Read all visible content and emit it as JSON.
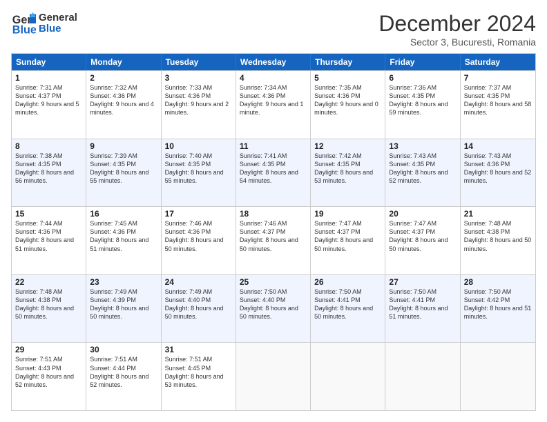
{
  "logo": {
    "line1": "General",
    "line2": "Blue"
  },
  "title": "December 2024",
  "subtitle": "Sector 3, Bucuresti, Romania",
  "header": {
    "days": [
      "Sunday",
      "Monday",
      "Tuesday",
      "Wednesday",
      "Thursday",
      "Friday",
      "Saturday"
    ]
  },
  "rows": [
    {
      "alt": false,
      "cells": [
        {
          "day": "1",
          "sunrise": "Sunrise: 7:31 AM",
          "sunset": "Sunset: 4:37 PM",
          "daylight": "Daylight: 9 hours and 5 minutes."
        },
        {
          "day": "2",
          "sunrise": "Sunrise: 7:32 AM",
          "sunset": "Sunset: 4:36 PM",
          "daylight": "Daylight: 9 hours and 4 minutes."
        },
        {
          "day": "3",
          "sunrise": "Sunrise: 7:33 AM",
          "sunset": "Sunset: 4:36 PM",
          "daylight": "Daylight: 9 hours and 2 minutes."
        },
        {
          "day": "4",
          "sunrise": "Sunrise: 7:34 AM",
          "sunset": "Sunset: 4:36 PM",
          "daylight": "Daylight: 9 hours and 1 minute."
        },
        {
          "day": "5",
          "sunrise": "Sunrise: 7:35 AM",
          "sunset": "Sunset: 4:36 PM",
          "daylight": "Daylight: 9 hours and 0 minutes."
        },
        {
          "day": "6",
          "sunrise": "Sunrise: 7:36 AM",
          "sunset": "Sunset: 4:35 PM",
          "daylight": "Daylight: 8 hours and 59 minutes."
        },
        {
          "day": "7",
          "sunrise": "Sunrise: 7:37 AM",
          "sunset": "Sunset: 4:35 PM",
          "daylight": "Daylight: 8 hours and 58 minutes."
        }
      ]
    },
    {
      "alt": true,
      "cells": [
        {
          "day": "8",
          "sunrise": "Sunrise: 7:38 AM",
          "sunset": "Sunset: 4:35 PM",
          "daylight": "Daylight: 8 hours and 56 minutes."
        },
        {
          "day": "9",
          "sunrise": "Sunrise: 7:39 AM",
          "sunset": "Sunset: 4:35 PM",
          "daylight": "Daylight: 8 hours and 55 minutes."
        },
        {
          "day": "10",
          "sunrise": "Sunrise: 7:40 AM",
          "sunset": "Sunset: 4:35 PM",
          "daylight": "Daylight: 8 hours and 55 minutes."
        },
        {
          "day": "11",
          "sunrise": "Sunrise: 7:41 AM",
          "sunset": "Sunset: 4:35 PM",
          "daylight": "Daylight: 8 hours and 54 minutes."
        },
        {
          "day": "12",
          "sunrise": "Sunrise: 7:42 AM",
          "sunset": "Sunset: 4:35 PM",
          "daylight": "Daylight: 8 hours and 53 minutes."
        },
        {
          "day": "13",
          "sunrise": "Sunrise: 7:43 AM",
          "sunset": "Sunset: 4:35 PM",
          "daylight": "Daylight: 8 hours and 52 minutes."
        },
        {
          "day": "14",
          "sunrise": "Sunrise: 7:43 AM",
          "sunset": "Sunset: 4:36 PM",
          "daylight": "Daylight: 8 hours and 52 minutes."
        }
      ]
    },
    {
      "alt": false,
      "cells": [
        {
          "day": "15",
          "sunrise": "Sunrise: 7:44 AM",
          "sunset": "Sunset: 4:36 PM",
          "daylight": "Daylight: 8 hours and 51 minutes."
        },
        {
          "day": "16",
          "sunrise": "Sunrise: 7:45 AM",
          "sunset": "Sunset: 4:36 PM",
          "daylight": "Daylight: 8 hours and 51 minutes."
        },
        {
          "day": "17",
          "sunrise": "Sunrise: 7:46 AM",
          "sunset": "Sunset: 4:36 PM",
          "daylight": "Daylight: 8 hours and 50 minutes."
        },
        {
          "day": "18",
          "sunrise": "Sunrise: 7:46 AM",
          "sunset": "Sunset: 4:37 PM",
          "daylight": "Daylight: 8 hours and 50 minutes."
        },
        {
          "day": "19",
          "sunrise": "Sunrise: 7:47 AM",
          "sunset": "Sunset: 4:37 PM",
          "daylight": "Daylight: 8 hours and 50 minutes."
        },
        {
          "day": "20",
          "sunrise": "Sunrise: 7:47 AM",
          "sunset": "Sunset: 4:37 PM",
          "daylight": "Daylight: 8 hours and 50 minutes."
        },
        {
          "day": "21",
          "sunrise": "Sunrise: 7:48 AM",
          "sunset": "Sunset: 4:38 PM",
          "daylight": "Daylight: 8 hours and 50 minutes."
        }
      ]
    },
    {
      "alt": true,
      "cells": [
        {
          "day": "22",
          "sunrise": "Sunrise: 7:48 AM",
          "sunset": "Sunset: 4:38 PM",
          "daylight": "Daylight: 8 hours and 50 minutes."
        },
        {
          "day": "23",
          "sunrise": "Sunrise: 7:49 AM",
          "sunset": "Sunset: 4:39 PM",
          "daylight": "Daylight: 8 hours and 50 minutes."
        },
        {
          "day": "24",
          "sunrise": "Sunrise: 7:49 AM",
          "sunset": "Sunset: 4:40 PM",
          "daylight": "Daylight: 8 hours and 50 minutes."
        },
        {
          "day": "25",
          "sunrise": "Sunrise: 7:50 AM",
          "sunset": "Sunset: 4:40 PM",
          "daylight": "Daylight: 8 hours and 50 minutes."
        },
        {
          "day": "26",
          "sunrise": "Sunrise: 7:50 AM",
          "sunset": "Sunset: 4:41 PM",
          "daylight": "Daylight: 8 hours and 50 minutes."
        },
        {
          "day": "27",
          "sunrise": "Sunrise: 7:50 AM",
          "sunset": "Sunset: 4:41 PM",
          "daylight": "Daylight: 8 hours and 51 minutes."
        },
        {
          "day": "28",
          "sunrise": "Sunrise: 7:50 AM",
          "sunset": "Sunset: 4:42 PM",
          "daylight": "Daylight: 8 hours and 51 minutes."
        }
      ]
    },
    {
      "alt": false,
      "cells": [
        {
          "day": "29",
          "sunrise": "Sunrise: 7:51 AM",
          "sunset": "Sunset: 4:43 PM",
          "daylight": "Daylight: 8 hours and 52 minutes."
        },
        {
          "day": "30",
          "sunrise": "Sunrise: 7:51 AM",
          "sunset": "Sunset: 4:44 PM",
          "daylight": "Daylight: 8 hours and 52 minutes."
        },
        {
          "day": "31",
          "sunrise": "Sunrise: 7:51 AM",
          "sunset": "Sunset: 4:45 PM",
          "daylight": "Daylight: 8 hours and 53 minutes."
        },
        {
          "day": "",
          "sunrise": "",
          "sunset": "",
          "daylight": ""
        },
        {
          "day": "",
          "sunrise": "",
          "sunset": "",
          "daylight": ""
        },
        {
          "day": "",
          "sunrise": "",
          "sunset": "",
          "daylight": ""
        },
        {
          "day": "",
          "sunrise": "",
          "sunset": "",
          "daylight": ""
        }
      ]
    }
  ]
}
